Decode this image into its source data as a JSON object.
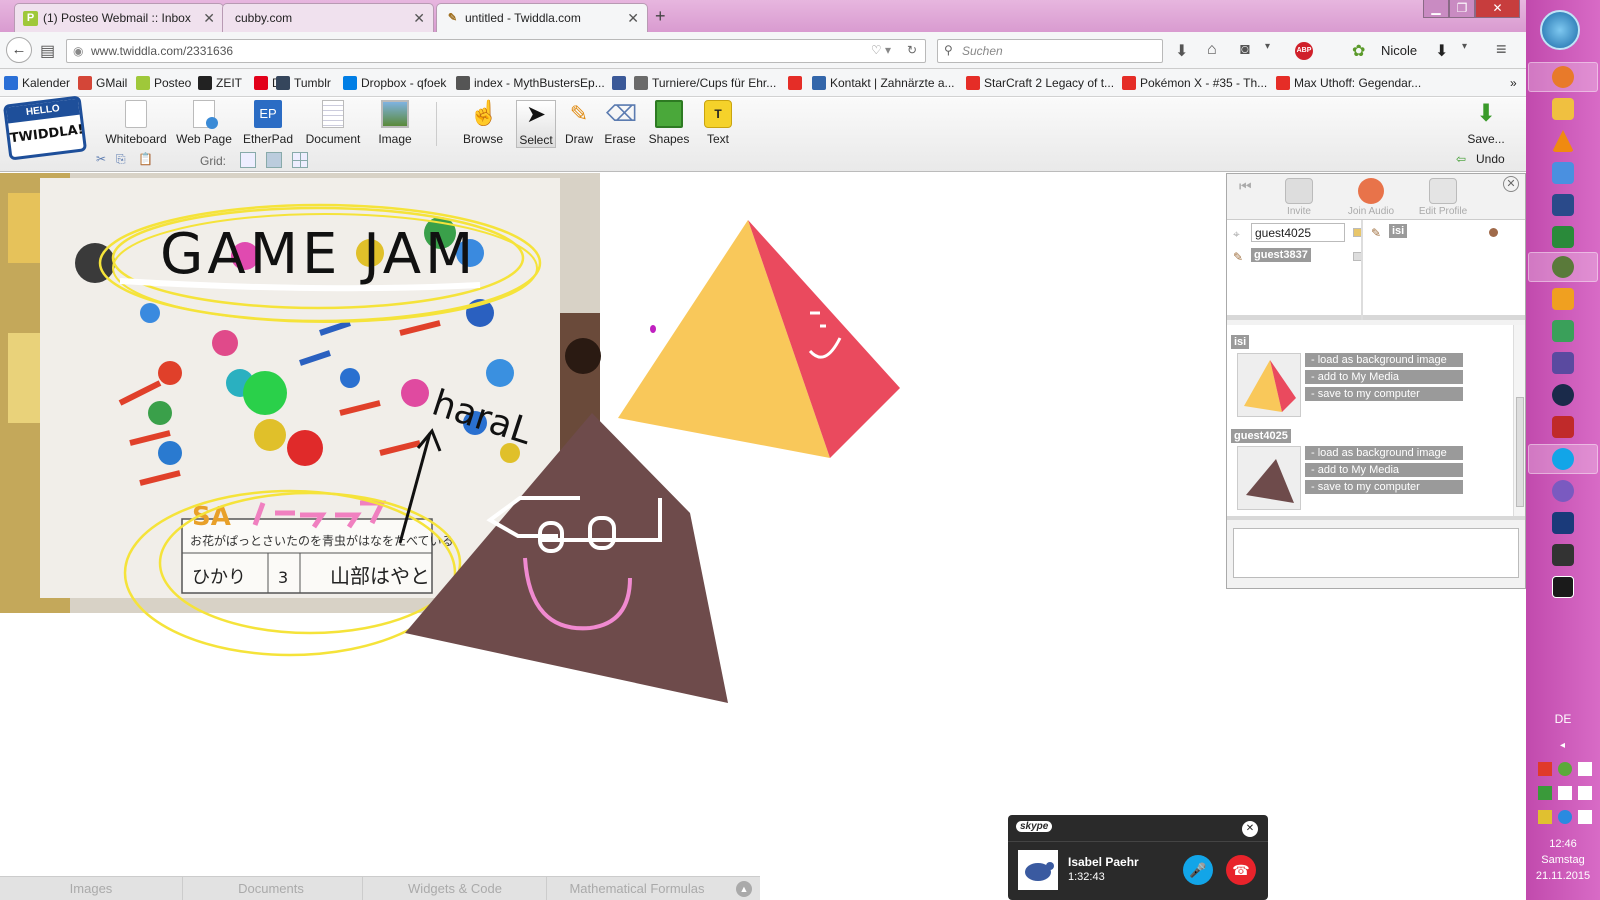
{
  "browser": {
    "tabs": [
      {
        "title": "(1) Posteo Webmail :: Inbox",
        "favicon": "P",
        "active": false
      },
      {
        "title": "cubby.com",
        "favicon": "",
        "active": false
      },
      {
        "title": "untitled - Twiddla.com",
        "favicon": "pencil",
        "active": true
      }
    ],
    "url": "www.twiddla.com/2331636",
    "search_placeholder": "Suchen",
    "user_name": "Nicole",
    "adblock_label": "ABP"
  },
  "bookmarks": [
    {
      "label": "Kalender",
      "color": "#2a6fd6"
    },
    {
      "label": "GMail",
      "color": "#d44638"
    },
    {
      "label": "Posteo",
      "color": "#9fc83a"
    },
    {
      "label": "ZEIT",
      "color": "#222222"
    },
    {
      "label": "DB",
      "color": "#e2001a"
    },
    {
      "label": "Tumblr",
      "color": "#35465c"
    },
    {
      "label": "Dropbox - qfoek",
      "color": "#007ee5"
    },
    {
      "label": "index - MythBustersEp...",
      "color": "#555555"
    },
    {
      "label": "",
      "color": "#3b5998"
    },
    {
      "label": "Turniere/Cups für Ehr...",
      "color": "#6a6a6a"
    },
    {
      "label": "",
      "color": "#e52d27"
    },
    {
      "label": "Kontakt | Zahnärzte a...",
      "color": "#3366aa"
    },
    {
      "label": "StarCraft 2 Legacy of t...",
      "color": "#e52d27"
    },
    {
      "label": "Pokémon X - #35 - Th...",
      "color": "#e52d27"
    },
    {
      "label": "Max Uthoff: Gegendar...",
      "color": "#e52d27"
    }
  ],
  "twiddla": {
    "logo_line1": "HELLO",
    "logo_line2": "TWIDDLA!",
    "tools_left": [
      "Whiteboard",
      "Web Page",
      "EtherPad",
      "Document",
      "Image"
    ],
    "tools_right": [
      "Browse",
      "Select",
      "Draw",
      "Erase",
      "Shapes",
      "Text"
    ],
    "etherpad_icon_text": "EP",
    "text_icon_text": "T",
    "save_label": "Save...",
    "grid_label": "Grid:",
    "undo_label": "Undo"
  },
  "canvas": {
    "handwriting": [
      "GAME JAM",
      "haraL"
    ],
    "photo_text": {
      "sa": "SA",
      "name1": "ひかり",
      "num": "3",
      "name2": "山部はやと",
      "caption": "お花がぱっとさいたのを青虫がはなをたべている"
    }
  },
  "panel": {
    "buttons": [
      "Invite",
      "Join Audio",
      "Edit Profile"
    ],
    "users": [
      {
        "name": "guest4025",
        "color": "#e8c66a"
      },
      {
        "name": "guest3837",
        "color": "#dddddd"
      }
    ],
    "other_user": "isi",
    "media": [
      {
        "owner": "isi",
        "actions": [
          "- load as background image",
          "- add to My Media",
          "- save to my computer"
        ]
      },
      {
        "owner": "guest4025",
        "actions": [
          "- load as background image",
          "- add to My Media",
          "- save to my computer"
        ]
      }
    ]
  },
  "bottom_tabs": [
    "Images",
    "Documents",
    "Widgets & Code",
    "Mathematical Formulas"
  ],
  "skype": {
    "brand": "skype",
    "contact": "Isabel Paehr",
    "duration": "1:32:43"
  },
  "taskbar": {
    "language": "DE",
    "time": "12:46",
    "day": "Samstag",
    "date": "21.11.2015"
  }
}
